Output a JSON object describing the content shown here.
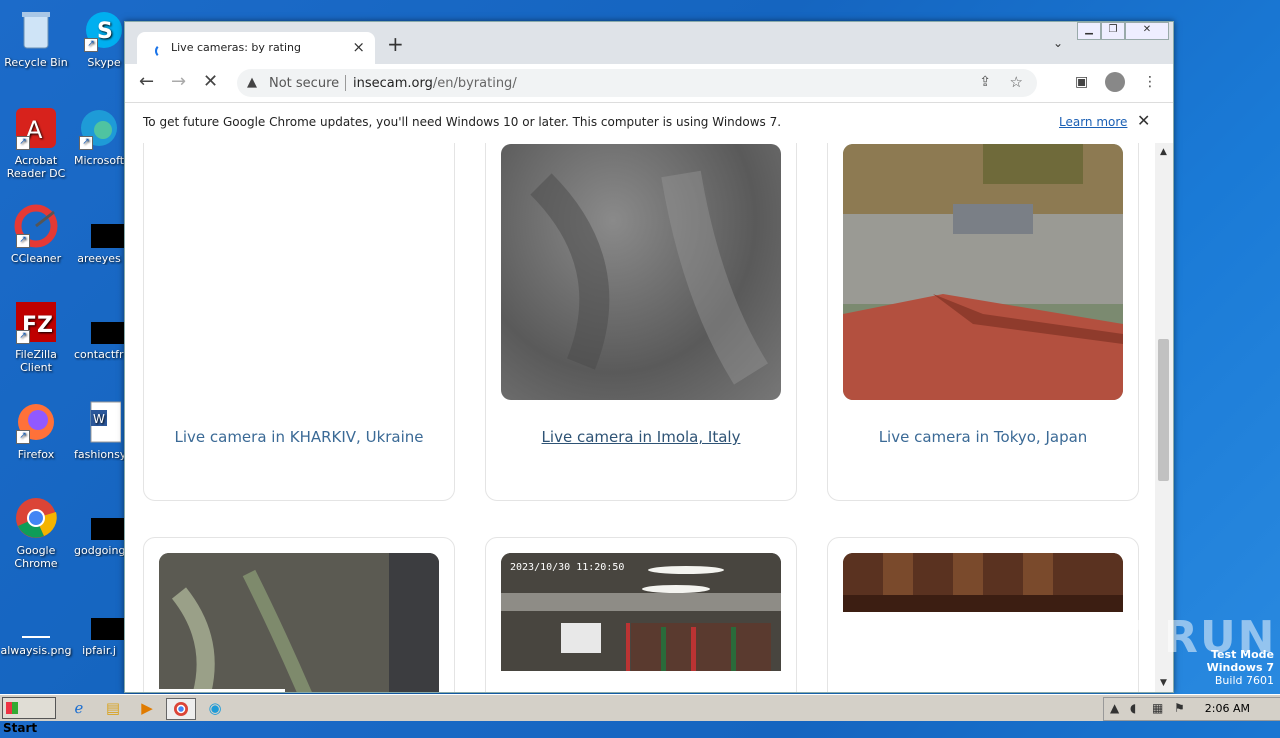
{
  "desktop": {
    "icons": [
      {
        "label": "Recycle Bin"
      },
      {
        "label": "Skype"
      },
      {
        "label": "Acrobat Reader DC"
      },
      {
        "label": "Microsoft"
      },
      {
        "label": "CCleaner"
      },
      {
        "label": "areeyes"
      },
      {
        "label": "FileZilla Client"
      },
      {
        "label": "contactfri"
      },
      {
        "label": "Firefox"
      },
      {
        "label": "fashionsy"
      },
      {
        "label": "Google Chrome"
      },
      {
        "label": "godgoing"
      },
      {
        "label": "alwaysis.png"
      },
      {
        "label": "ipfair.j"
      }
    ],
    "watermark": "ANY RUN",
    "test_mode": {
      "line1": "Test Mode",
      "line2": "Windows 7",
      "line3": "Build 7601"
    }
  },
  "browser": {
    "tab_title": "Live cameras: by rating",
    "new_tab_label": "+",
    "security_label": "Not secure",
    "url_host": "insecam.org",
    "url_path": "/en/byrating/",
    "infobar_message": "To get future Google Chrome updates, you'll need Windows 10 or later. This computer is using Windows 7.",
    "infobar_link": "Learn more"
  },
  "cameras": [
    {
      "caption": "Live camera in KHARKIV, Ukraine"
    },
    {
      "caption": "Live camera in Imola, Italy"
    },
    {
      "caption": "Live camera in Tokyo, Japan"
    },
    {
      "caption": "",
      "timestamp": ""
    },
    {
      "caption": "",
      "timestamp": "2023/10/30  11:20:50"
    },
    {
      "caption": ""
    }
  ],
  "taskbar": {
    "start_label": "Start",
    "clock": "2:06 AM"
  },
  "colors": {
    "link": "#3b6a96",
    "desktop": "#1565c0",
    "accent": "#1a73e8"
  }
}
